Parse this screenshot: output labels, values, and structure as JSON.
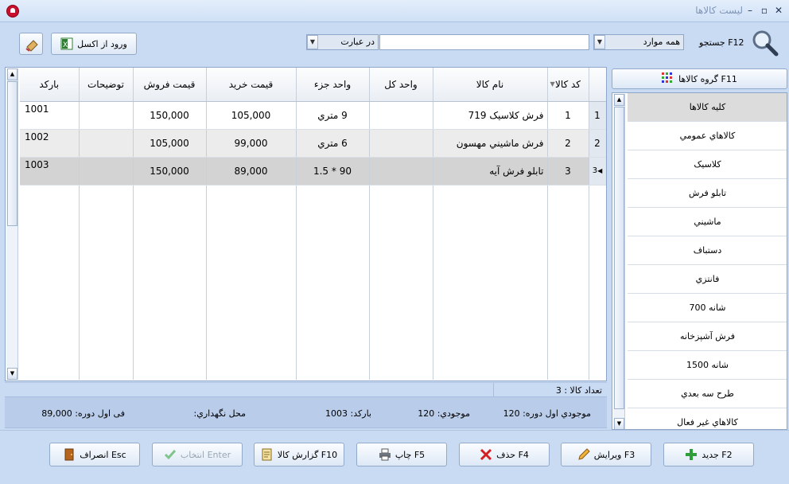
{
  "window": {
    "title": "ليست كالاها",
    "minimize": "–",
    "maximize": "▫",
    "close": "✕"
  },
  "toolbar": {
    "search_label": "جستجو F12",
    "field_combo": "همه موارد",
    "match_combo": "در عبارت",
    "search_value": "",
    "excel_button": "ورود از اکسل"
  },
  "grid": {
    "columns": [
      "كد كالا",
      "نام كالا",
      "واحد كل",
      "واحد جزء",
      "قيمت خريد",
      "قيمت فروش",
      "توضيحات",
      "باركد"
    ],
    "rows": [
      {
        "row": "1",
        "code": "1",
        "name": "فرش كلاسيک 719",
        "unit_total": "",
        "unit_part": "9 متري",
        "buy": "105,000",
        "sell": "150,000",
        "desc": "",
        "barcode": "1001"
      },
      {
        "row": "2",
        "code": "2",
        "name": "فرش ماشيني مهسون",
        "unit_total": "",
        "unit_part": "6 متري",
        "buy": "99,000",
        "sell": "105,000",
        "desc": "",
        "barcode": "1002"
      },
      {
        "row": "3",
        "code": "3",
        "name": "تابلو فرش آيه",
        "unit_total": "",
        "unit_part": "90 * 1.5",
        "buy": "89,000",
        "sell": "150,000",
        "desc": "",
        "barcode": "1003"
      }
    ],
    "count_label": "تعداد كالا : 3"
  },
  "details": {
    "opening_stock": "موجودي اول دوره: 120",
    "stock": "موجودي: 120",
    "barcode": "باركد: 1003",
    "location": "محل نگهداري:",
    "opening_price": "فی اول دوره: 89,000"
  },
  "groups": {
    "button": "گروه كالاها F11",
    "items": [
      "كليه كالاها",
      "كالاهاي عمومي",
      "كلاسيک",
      "تابلو فرش",
      "ماشيني",
      "دستباف",
      "فانتزي",
      "700 شانه",
      "فرش آشپزخانه",
      "1500 شانه",
      "طرح سه بعدي",
      "كالاهاي غير فعال"
    ]
  },
  "actions": {
    "new": "جديد F2",
    "edit": "ويرايش F3",
    "delete": "حذف F4",
    "print": "چاپ F5",
    "report": "گزارش كالا F10",
    "select": "انتخاب Enter",
    "cancel": "انصراف Esc"
  },
  "colors": {
    "background": "#c9daf3",
    "selected_row": "#d3d3d3",
    "alt_row": "#ececec"
  }
}
